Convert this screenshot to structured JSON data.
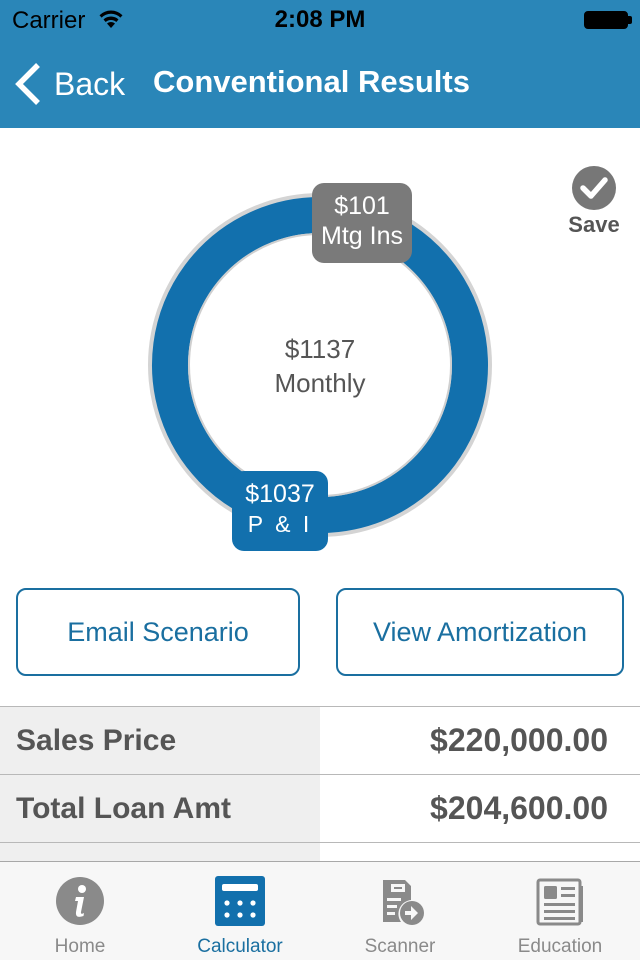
{
  "status_bar": {
    "carrier": "Carrier",
    "time": "2:08 PM"
  },
  "nav": {
    "back_label": "Back",
    "title": "Conventional Results"
  },
  "colors": {
    "header": "#2a86b8",
    "primary": "#1a6fa0",
    "ring_pi": "#1270ad",
    "ring_mtg": "#7a7a7a"
  },
  "payment_chart": {
    "total_value": "$1137",
    "total_label": "Monthly",
    "segments": [
      {
        "name": "P & I",
        "value": 1037,
        "value_label": "$1037",
        "label": "P & I"
      },
      {
        "name": "Mtg Ins",
        "value": 101,
        "value_label": "$101",
        "label": "Mtg Ins"
      }
    ]
  },
  "save": {
    "label": "Save"
  },
  "actions": {
    "email_label": "Email Scenario",
    "amortization_label": "View Amortization"
  },
  "details": [
    {
      "label": "Sales Price",
      "value": "$220,000.00"
    },
    {
      "label": "Total Loan Amt",
      "value": "$204,600.00"
    },
    {
      "label": "",
      "value": ""
    }
  ],
  "tabs": [
    {
      "label": "Home",
      "icon": "info-icon",
      "active": false
    },
    {
      "label": "Calculator",
      "icon": "calculator-icon",
      "active": true
    },
    {
      "label": "Scanner",
      "icon": "scanner-icon",
      "active": false
    },
    {
      "label": "Education",
      "icon": "newspaper-icon",
      "active": false
    }
  ]
}
